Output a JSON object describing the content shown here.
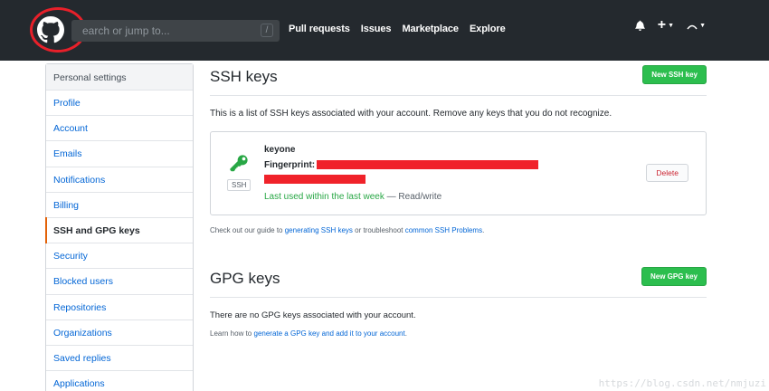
{
  "header": {
    "search_placeholder": "earch or jump to...",
    "slash_key": "/",
    "nav": [
      "Pull requests",
      "Issues",
      "Marketplace",
      "Explore"
    ],
    "icons": [
      "bell-icon",
      "plus-icon",
      "avatar-icon"
    ]
  },
  "sidebar": {
    "header": "Personal settings",
    "items": [
      {
        "label": "Profile"
      },
      {
        "label": "Account"
      },
      {
        "label": "Emails"
      },
      {
        "label": "Notifications"
      },
      {
        "label": "Billing"
      },
      {
        "label": "SSH and GPG keys",
        "selected": true
      },
      {
        "label": "Security"
      },
      {
        "label": "Blocked users"
      },
      {
        "label": "Repositories"
      },
      {
        "label": "Organizations"
      },
      {
        "label": "Saved replies"
      },
      {
        "label": "Applications"
      }
    ]
  },
  "ssh": {
    "title": "SSH keys",
    "new_button": "New SSH key",
    "description": "This is a list of SSH keys associated with your account. Remove any keys that you do not recognize.",
    "key": {
      "name": "keyone",
      "fingerprint_label": "Fingerprint:",
      "badge": "SSH",
      "last_used": "Last used within the last week",
      "access": "— Read/write",
      "delete_button": "Delete"
    },
    "guide_prefix": "Check out our guide to",
    "guide_link1": "generating SSH keys",
    "guide_mid": "or troubleshoot",
    "guide_link2": "common SSH Problems",
    "guide_suffix": "."
  },
  "gpg": {
    "title": "GPG keys",
    "new_button": "New GPG key",
    "description": "There are no GPG keys associated with your account.",
    "learn_prefix": "Learn how to",
    "learn_link": "generate a GPG key and add it to your account",
    "learn_suffix": "."
  },
  "colors": {
    "header_bg": "#24292e",
    "green": "#2cbe4e",
    "link": "#0366d6",
    "redaction": "#f0222a",
    "annotation_circle": "#e8202a"
  },
  "watermark": "https://blog.csdn.net/nmjuzi"
}
